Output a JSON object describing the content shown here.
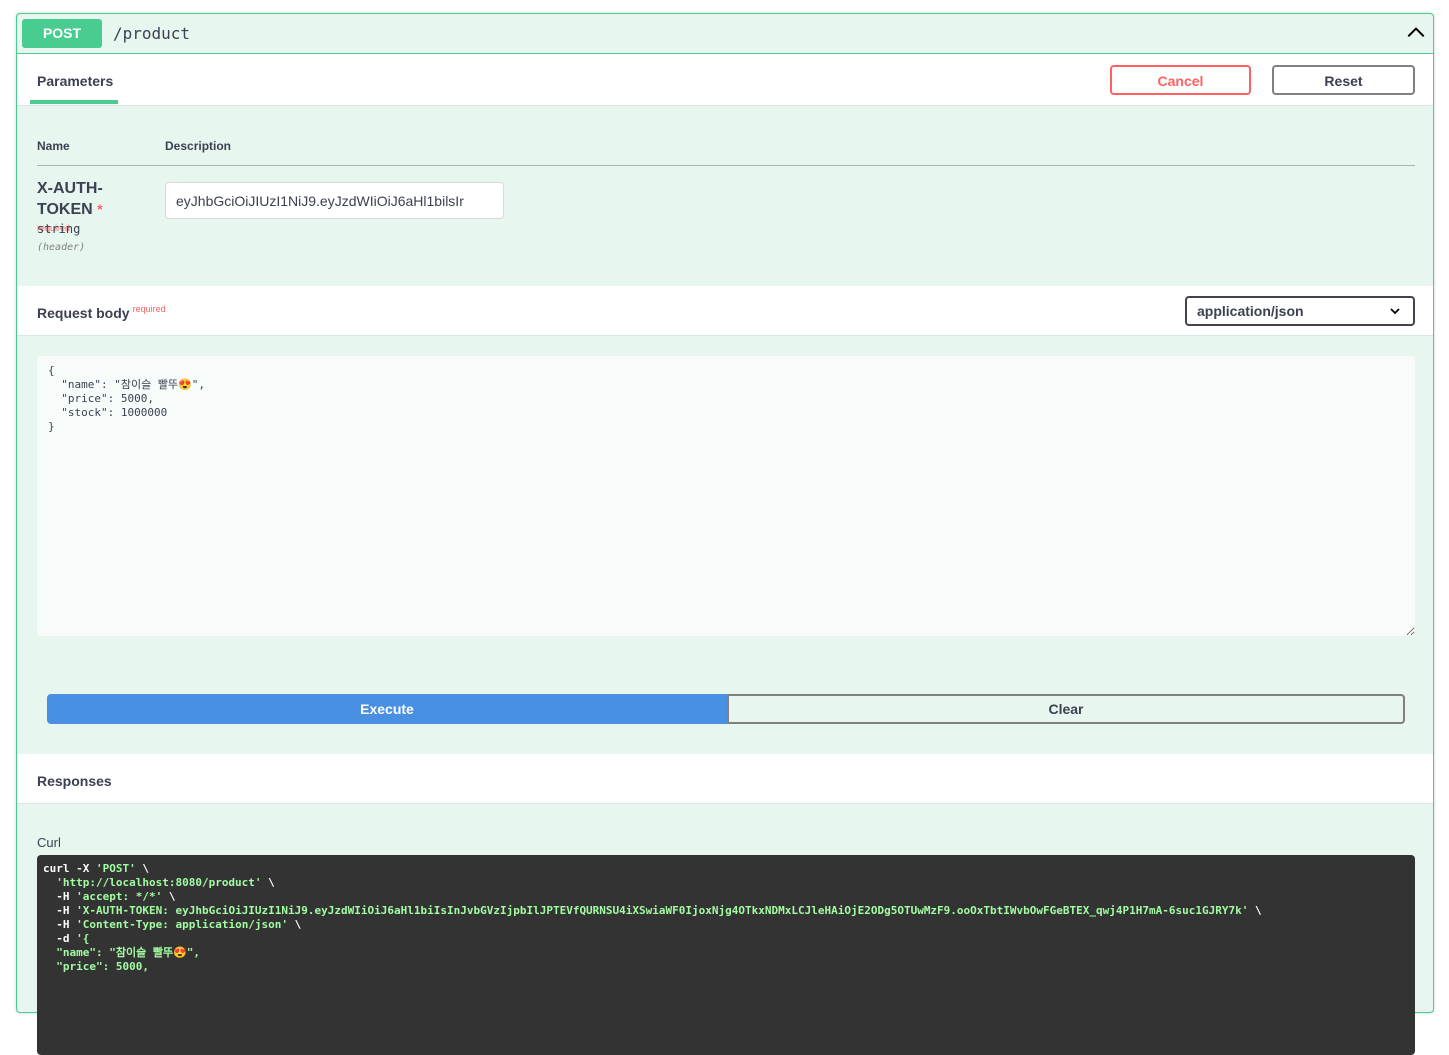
{
  "operation": {
    "method": "POST",
    "path": "/product",
    "collapse_icon": "chevron-up-icon",
    "accent_color": "#49cc90"
  },
  "tabs": {
    "parameters_label": "Parameters",
    "cancel_label": "Cancel",
    "reset_label": "Reset"
  },
  "params_table": {
    "name_header": "Name",
    "description_header": "Description",
    "rows": [
      {
        "name_line1": "X-AUTH-",
        "name_line2": "TOKEN",
        "required_star": "*",
        "required_text": "required",
        "type": "string",
        "in": "(header)",
        "value": "eyJhbGciOiJIUzI1NiJ9.eyJzdWIiOiJ6aHl1bilsIr"
      }
    ]
  },
  "request_body": {
    "title": "Request body",
    "required_text": "required",
    "content_type": "application/json",
    "content": "{\n  \"name\": \"참이슬 빨뚜😍\",\n  \"price\": 5000,\n  \"stock\": 1000000\n}"
  },
  "actions": {
    "execute_label": "Execute",
    "clear_label": "Clear",
    "execute_color": "#4990e2"
  },
  "responses": {
    "title": "Responses",
    "curl_label": "Curl",
    "curl_lines": [
      {
        "plain": "curl -X ",
        "str": "'POST'",
        "tail": " \\"
      },
      {
        "plain": "  ",
        "str": "'http://localhost:8080/product'",
        "tail": " \\"
      },
      {
        "plain": "  -H ",
        "str": "'accept: */*'",
        "tail": " \\"
      },
      {
        "plain": "  -H ",
        "str": "'X-AUTH-TOKEN: eyJhbGciOiJIUzI1NiJ9.eyJzdWIiOiJ6aHl1biIsInJvbGVzIjpbIlJPTEVfQURNSU4iXSwiaWF0IjoxNjg4OTkxNDMxLCJleHAiOjE2ODg5OTUwMzF9.ooOxTbtIWvbOwFGeBTEX_qwj4P1H7mA-6suc1GJRY7k'",
        "tail": " \\"
      },
      {
        "plain": "  -H ",
        "str": "'Content-Type: application/json'",
        "tail": " \\"
      },
      {
        "plain": "  -d ",
        "str": "'{",
        "tail": ""
      },
      {
        "plain": "  ",
        "str": "\"name\": \"참이슬 빨뚜😍\",",
        "tail": ""
      },
      {
        "plain": "  ",
        "str": "\"price\": 5000,",
        "tail": ""
      }
    ]
  }
}
